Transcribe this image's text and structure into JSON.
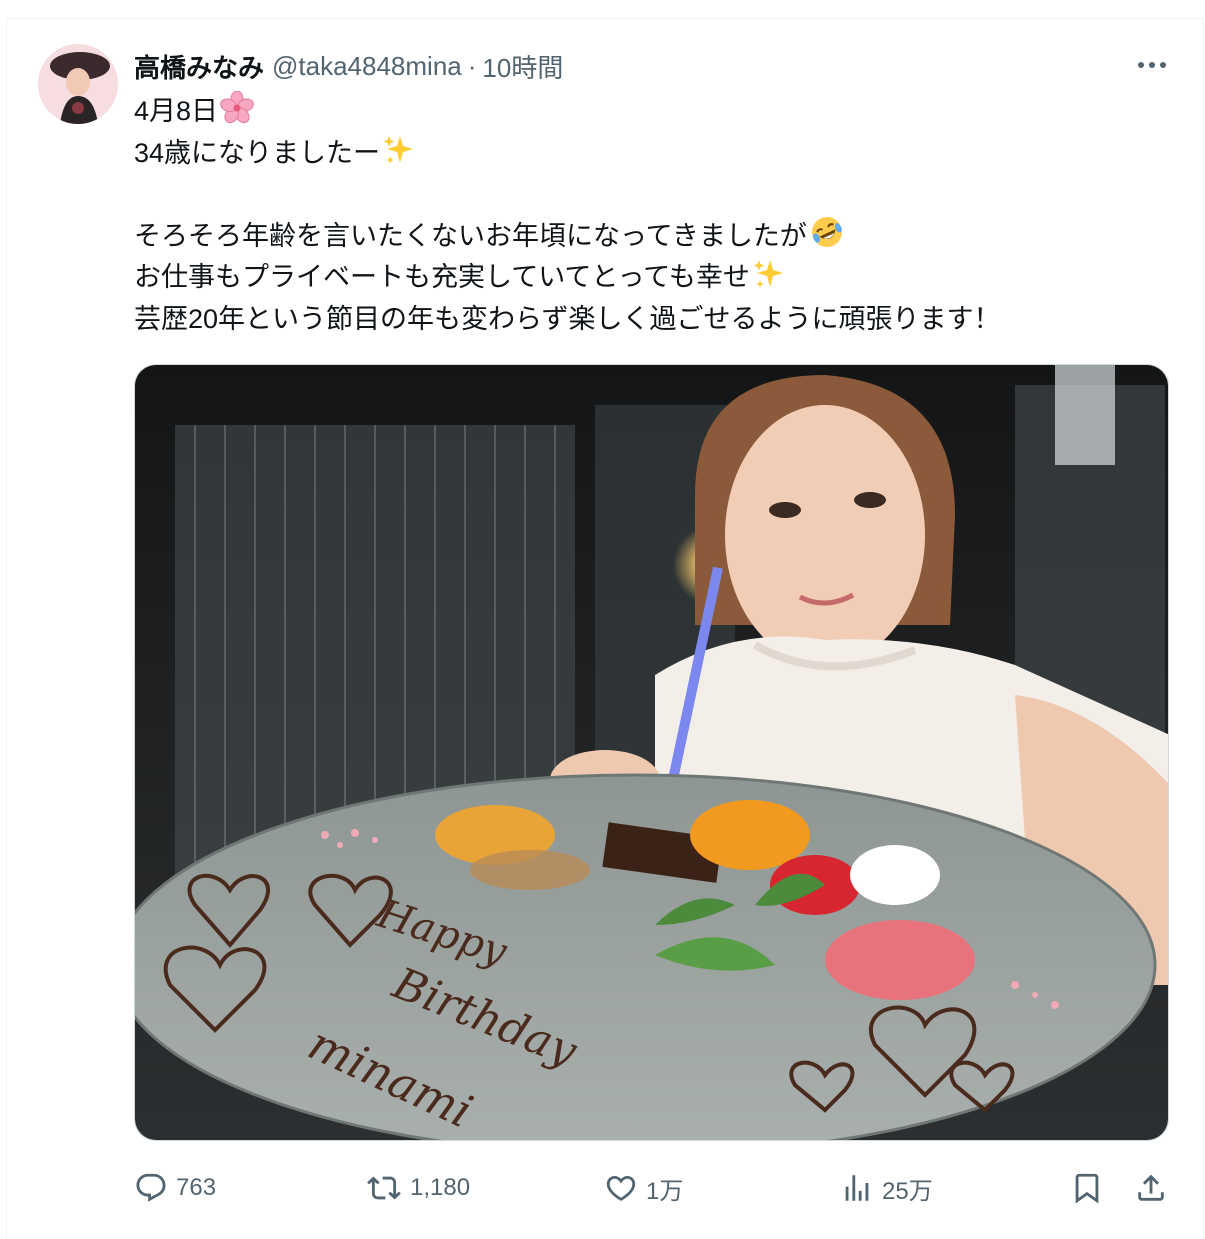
{
  "tweet": {
    "author_name": "高橋みなみ",
    "handle": "@taka4848mina",
    "separator": "·",
    "time": "10時間",
    "lines": [
      "4月8日",
      "34歳になりましたー",
      "そろそろ年齢を言いたくないお年頃になってきましたが",
      "お仕事もプライベートも充実していてとっても幸せ",
      "芸歴20年という節目の年も変わらず楽しく過ごせるように頑張ります！"
    ],
    "emojis": {
      "line1": "cherry-blossom",
      "line2": "sparkles",
      "line3": "rolling-on-floor-laughing",
      "line4": "sparkles"
    },
    "media": {
      "handwriting_on_plate": [
        "Happy",
        "Birthday",
        "minami"
      ]
    }
  },
  "actions": {
    "reply_count": "763",
    "retweet_count": "1,180",
    "like_count": "1万",
    "view_count": "25万"
  },
  "colors": {
    "text": "#0f1419",
    "secondary": "#536471",
    "border": "#cfd9de"
  }
}
